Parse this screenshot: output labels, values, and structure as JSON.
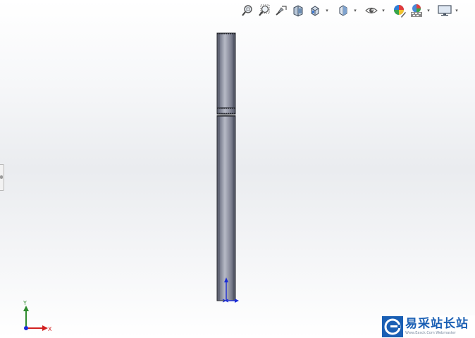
{
  "toolbar": {
    "buttons": [
      {
        "name": "zoom-to-fit-icon",
        "has_dropdown": false
      },
      {
        "name": "zoom-to-area-icon",
        "has_dropdown": false
      },
      {
        "name": "previous-view-icon",
        "has_dropdown": false
      },
      {
        "name": "section-view-icon",
        "has_dropdown": false
      },
      {
        "name": "view-orientation-icon",
        "has_dropdown": true
      },
      {
        "name": "display-style-icon",
        "has_dropdown": true
      },
      {
        "name": "hide-show-items-icon",
        "has_dropdown": true
      },
      {
        "name": "edit-appearance-icon",
        "has_dropdown": false
      },
      {
        "name": "apply-scene-icon",
        "has_dropdown": true
      },
      {
        "name": "view-settings-icon",
        "has_dropdown": true
      }
    ]
  },
  "triad": {
    "y_label": "Y",
    "x_label": "X"
  },
  "watermark": {
    "title": "易采站长站",
    "subtitle": "Www.Easck.Com Webmaster"
  },
  "colors": {
    "part_body": "#7e8291",
    "triad_y": "#2e8b2e",
    "triad_x": "#d22020",
    "triad_z": "#1a2bd6",
    "watermark_blue": "#1a5fb4"
  }
}
